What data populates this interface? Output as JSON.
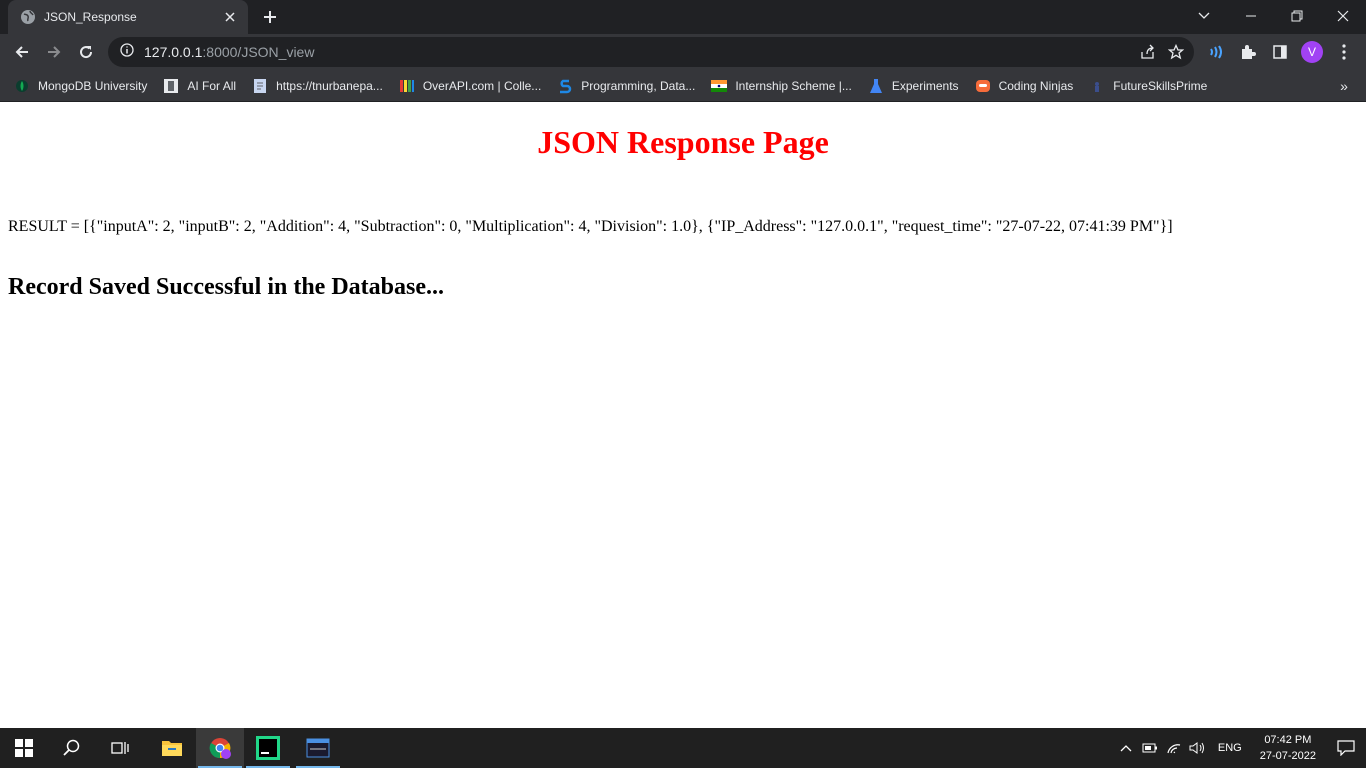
{
  "browser": {
    "tab": {
      "title": "JSON_Response",
      "favicon": "globe-icon"
    },
    "address": {
      "host": "127.0.0.1",
      "path": ":8000/JSON_view"
    },
    "profile_initial": "V",
    "bookmarks": [
      {
        "label": "MongoDB University",
        "icon": "mongodb-leaf-icon"
      },
      {
        "label": "AI For All",
        "icon": "ai-for-all-icon"
      },
      {
        "label": "https://tnurbanepa...",
        "icon": "document-icon"
      },
      {
        "label": "OverAPI.com | Colle...",
        "icon": "overapi-icon"
      },
      {
        "label": "Programming, Data...",
        "icon": "s-logo-icon"
      },
      {
        "label": "Internship Scheme |...",
        "icon": "india-flag-icon"
      },
      {
        "label": "Experiments",
        "icon": "flask-icon"
      },
      {
        "label": "Coding Ninjas",
        "icon": "coding-ninjas-icon"
      },
      {
        "label": "FutureSkillsPrime",
        "icon": "futureskills-icon"
      }
    ],
    "overflow_label": "»"
  },
  "page": {
    "heading": "JSON Response Page",
    "result_text": "RESULT = [{\"inputA\": 2, \"inputB\": 2, \"Addition\": 4, \"Subtraction\": 0, \"Multiplication\": 4, \"Division\": 1.0}, {\"IP_Address\": \"127.0.0.1\", \"request_time\": \"27-07-22, 07:41:39 PM\"}]",
    "status_message": "Record Saved Successful in the Database..."
  },
  "taskbar": {
    "language": "ENG",
    "time": "07:42 PM",
    "date": "27-07-2022"
  },
  "colors": {
    "heading": "#ff0000",
    "chrome_dark": "#202124",
    "chrome_toolbar": "#35363a",
    "avatar": "#a142f4",
    "taskbar": "#202020"
  }
}
